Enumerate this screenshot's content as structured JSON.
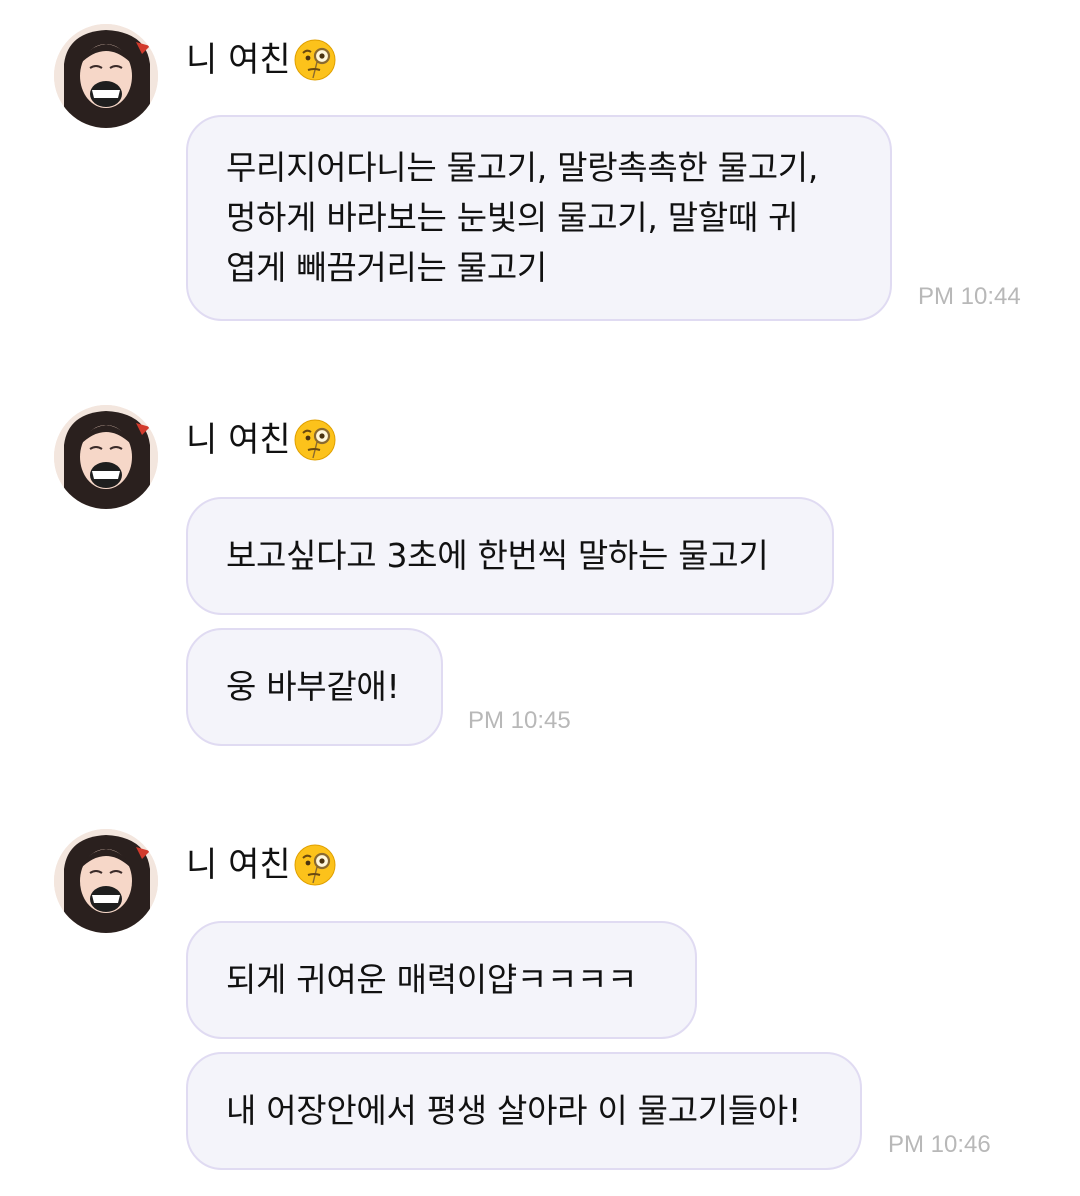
{
  "groups": [
    {
      "sender": "니 여친",
      "messages": [
        "무리지어다니는 물고기, 말랑촉촉한 물고기,\n멍하게 바라보는 눈빛의 물고기, 말할때 귀\n엽게 빼끔거리는 물고기"
      ],
      "time": "PM 10:44"
    },
    {
      "sender": "니 여친",
      "messages": [
        "보고싶다고 3초에 한번씩 말하는 물고기",
        "웅 바부같애!"
      ],
      "time": "PM 10:45"
    },
    {
      "sender": "니 여친",
      "messages": [
        "되게 귀여운 매력이얍ㅋㅋㅋㅋ",
        "내 어장안에서 평생 살아라 이 물고기들아!"
      ],
      "time": "PM 10:46"
    }
  ],
  "sender_emoji": "face-with-monocle-emoji",
  "colors": {
    "bubble_bg": "#f4f4fa",
    "bubble_border": "#e0dbf2",
    "timestamp": "#b8b8b8"
  }
}
